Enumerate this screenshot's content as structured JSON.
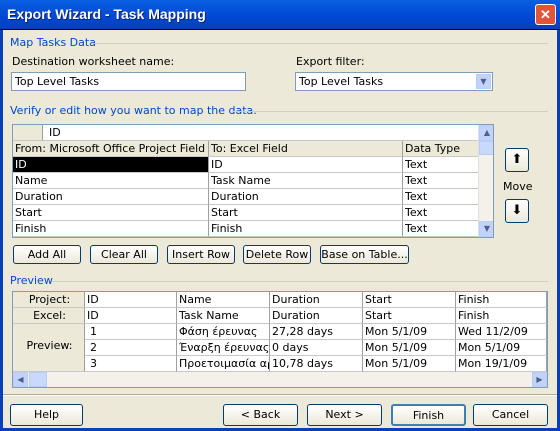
{
  "window": {
    "title": "Export Wizard - Task Mapping",
    "close": "✕"
  },
  "map_section": {
    "title": "Map Tasks Data",
    "dest_label": "Destination worksheet name:",
    "dest_value": "Top Level Tasks",
    "filter_label": "Export filter:",
    "filter_value": "Top Level Tasks"
  },
  "verify_label": "Verify or edit how you want to map the data.",
  "mapping": {
    "edit_value": "ID",
    "columns": [
      "From: Microsoft Office Project Field",
      "To:  Excel Field",
      "Data Type"
    ],
    "rows": [
      {
        "from": "ID",
        "to": "ID",
        "type": "Text"
      },
      {
        "from": "Name",
        "to": "Task Name",
        "type": "Text"
      },
      {
        "from": "Duration",
        "to": "Duration",
        "type": "Text"
      },
      {
        "from": "Start",
        "to": "Start",
        "type": "Text"
      },
      {
        "from": "Finish",
        "to": "Finish",
        "type": "Text"
      }
    ]
  },
  "move_label": "Move",
  "buttons": {
    "add_all": "Add All",
    "clear_all": "Clear All",
    "insert_row": "Insert Row",
    "delete_row": "Delete Row",
    "base_on_table": "Base on Table..."
  },
  "preview": {
    "title": "Preview",
    "row_labels": [
      "Project:",
      "Excel:",
      "Preview:"
    ],
    "project_fields": [
      "ID",
      "Name",
      "Duration",
      "Start",
      "Finish"
    ],
    "excel_fields": [
      "ID",
      "Task Name",
      "Duration",
      "Start",
      "Finish"
    ],
    "rows": [
      [
        "1",
        "Φάση έρευνας",
        "27,28 days",
        "Mon 5/1/09",
        "Wed 11/2/09"
      ],
      [
        "2",
        "Έναρξη έρευνας",
        "0 days",
        "Mon 5/1/09",
        "Mon 5/1/09"
      ],
      [
        "3",
        "Προετοιμασία αρχείων",
        "10,78 days",
        "Mon 5/1/09",
        "Mon 19/1/09"
      ]
    ]
  },
  "footer": {
    "help": "Help",
    "back": "< Back",
    "next": "Next >",
    "finish": "Finish",
    "cancel": "Cancel"
  }
}
